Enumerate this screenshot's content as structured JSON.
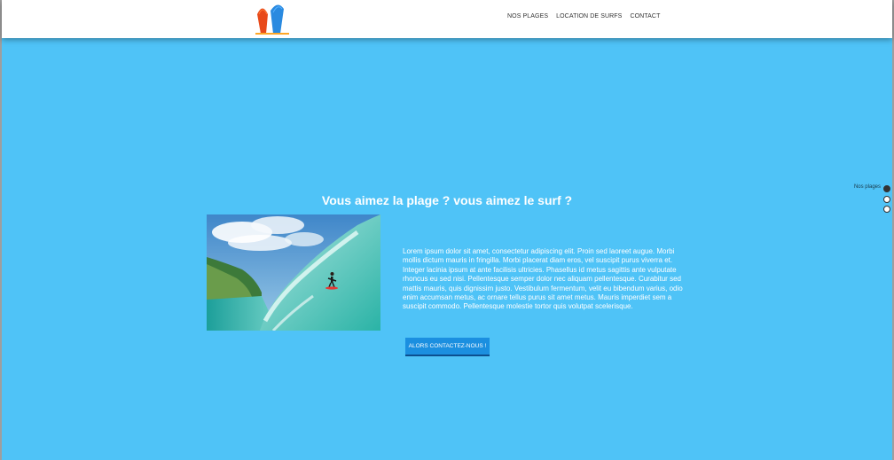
{
  "header": {
    "logo_icon": "surfboards-logo-icon",
    "nav": [
      {
        "label": "NOS PLAGES"
      },
      {
        "label": "LOCATION DE SURFS"
      },
      {
        "label": "CONTACT"
      }
    ]
  },
  "main": {
    "headline": "Vous aimez la plage ? vous aimez le surf ?",
    "image": {
      "icon": "surfer-wave-photo"
    },
    "paragraph": "Lorem ipsum dolor sit amet, consectetur adipiscing elit. Proin sed laoreet augue. Morbi mollis dictum mauris in fringilla. Morbi placerat diam eros, vel suscipit purus viverra et. Integer lacinia ipsum at ante facilisis ultricies. Phasellus id metus sagittis ante vulputate rhoncus eu sed nisi. Pellentesque semper dolor nec aliquam pellentesque. Curabitur sed mattis mauris, quis dignissim justo. Vestibulum fermentum, velit eu bibendum varius, odio enim accumsan metus, ac ornare tellus purus sit amet metus. Mauris imperdiet sem a suscipit commodo. Pellentesque molestie tortor quis volutpat scelerisque.",
    "cta_label": "ALORS CONTACTEZ-NOUS !"
  },
  "section_nav": {
    "active_label": "Nos plages",
    "dot_count": 3,
    "active_index": 0
  },
  "colors": {
    "background": "#4fc3f7",
    "button": "#1b8fe0",
    "header": "#ffffff"
  }
}
